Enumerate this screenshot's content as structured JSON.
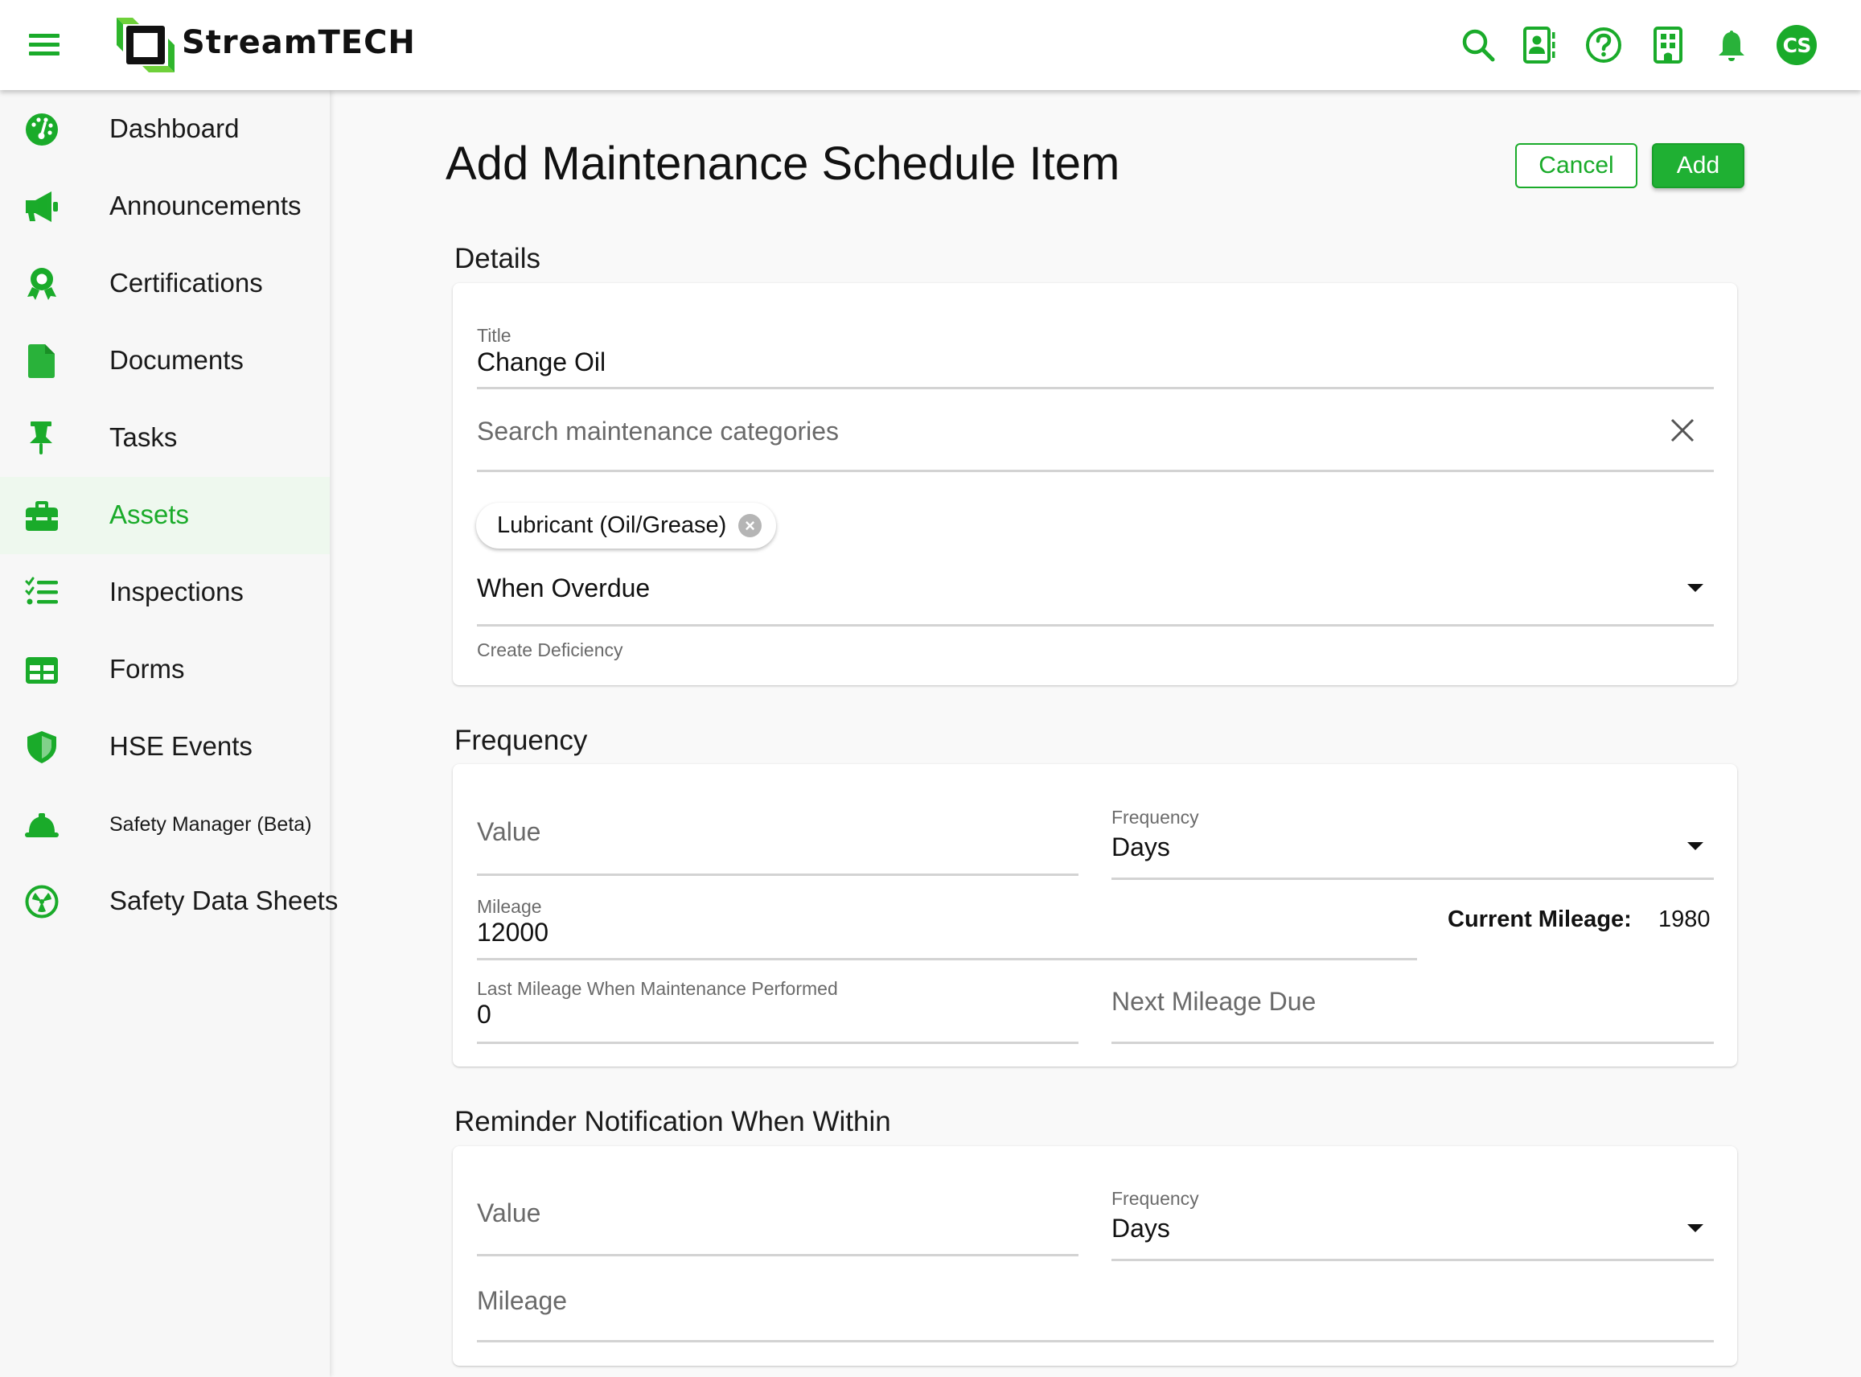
{
  "header": {
    "brand": "StreamTECH",
    "icons": [
      "menu-icon",
      "search-icon",
      "contacts-icon",
      "help-icon",
      "building-icon",
      "bell-icon"
    ],
    "avatar_initials": "CS",
    "accent_color": "#1aab2a"
  },
  "sidebar": {
    "items": [
      {
        "label": "Dashboard",
        "icon": "dashboard-gauge-icon",
        "active": false
      },
      {
        "label": "Announcements",
        "icon": "megaphone-icon",
        "active": false
      },
      {
        "label": "Certifications",
        "icon": "award-ribbon-icon",
        "active": false
      },
      {
        "label": "Documents",
        "icon": "document-icon",
        "active": false
      },
      {
        "label": "Tasks",
        "icon": "pushpin-icon",
        "active": false
      },
      {
        "label": "Assets",
        "icon": "toolbox-icon",
        "active": true
      },
      {
        "label": "Inspections",
        "icon": "checklist-icon",
        "active": false
      },
      {
        "label": "Forms",
        "icon": "table-form-icon",
        "active": false
      },
      {
        "label": "HSE Events",
        "icon": "shield-icon",
        "active": false
      },
      {
        "label": "Safety Manager (Beta)",
        "icon": "hard-hat-icon",
        "active": false
      },
      {
        "label": "Safety Data Sheets",
        "icon": "radiation-icon",
        "active": false
      }
    ]
  },
  "page": {
    "title": "Add Maintenance Schedule Item",
    "cancel_label": "Cancel",
    "add_label": "Add"
  },
  "details": {
    "section_title": "Details",
    "title_label": "Title",
    "title_value": "Change Oil",
    "category_search_placeholder": "Search maintenance categories",
    "selected_category_chip": "Lubricant (Oil/Grease)",
    "overdue_action_value": "When Overdue",
    "overdue_action_label": "Create Deficiency"
  },
  "frequency": {
    "section_title": "Frequency",
    "value_placeholder": "Value",
    "frequency_label": "Frequency",
    "frequency_value": "Days",
    "mileage_label": "Mileage",
    "mileage_value": "12000",
    "current_mileage_label": "Current Mileage:",
    "current_mileage_value": "1980",
    "last_mileage_label": "Last Mileage When Maintenance Performed",
    "last_mileage_value": "0",
    "next_mileage_placeholder": "Next Mileage Due"
  },
  "reminder": {
    "section_title": "Reminder Notification When Within",
    "value_placeholder": "Value",
    "frequency_label": "Frequency",
    "frequency_value": "Days",
    "mileage_placeholder": "Mileage"
  }
}
